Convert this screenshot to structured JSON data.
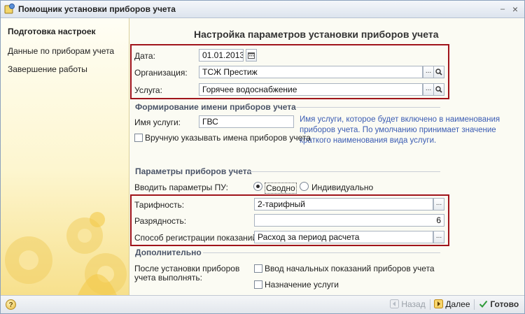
{
  "window": {
    "title": "Помощник установки приборов учета",
    "min_glyph": "–",
    "close_glyph": "×"
  },
  "sidebar": {
    "items": [
      {
        "label": "Подготовка настроек",
        "active": true
      },
      {
        "label": "Данные по приборам учета",
        "active": false
      },
      {
        "label": "Завершение работы",
        "active": false
      }
    ]
  },
  "main": {
    "heading": "Настройка параметров установки приборов учета",
    "date": {
      "label": "Дата:",
      "value": "01.01.2013"
    },
    "organization": {
      "label": "Организация:",
      "value": "ТСЖ Престиж"
    },
    "service": {
      "label": "Услуга:",
      "value": "Горячее водоснабжение"
    },
    "naming": {
      "title": "Формирование имени приборов учета",
      "service_name_label": "Имя услуги:",
      "service_name_value": "ГВС",
      "hint": "Имя услуги, которое будет включено в наименования приборов учета. По умолчанию принимает значение краткого наименования вида услуги.",
      "manual_label": "Вручную указывать имена приборов учета",
      "manual_checked": false
    },
    "params": {
      "title": "Параметры приборов учета",
      "mode_label": "Вводить параметры ПУ:",
      "mode_options": [
        "Сводно",
        "Индивидуально"
      ],
      "mode_selected": "Сводно",
      "tariff": {
        "label": "Тарифность:",
        "value": "2-тарифный"
      },
      "digits": {
        "label": "Разрядность:",
        "value": "6"
      },
      "reading": {
        "label": "Способ регистрации показаний:",
        "value": "Расход за период расчета"
      }
    },
    "extra": {
      "title": "Дополнительно",
      "after_label_1": "После установки приборов",
      "after_label_2": "учета выполнять:",
      "opt1": "Ввод начальных показаний приборов учета",
      "opt2": "Назначение услуги",
      "opt1_checked": false,
      "opt2_checked": false
    },
    "ellipsis": "...",
    "search_glyph": "🔍"
  },
  "footer": {
    "help_label": "?",
    "back_label": "Назад",
    "next_label": "Далее",
    "done_label": "Готово",
    "back_enabled": false,
    "colors": {
      "next_arrow": "#e6a21a",
      "done_check": "#2e9b3a"
    }
  }
}
